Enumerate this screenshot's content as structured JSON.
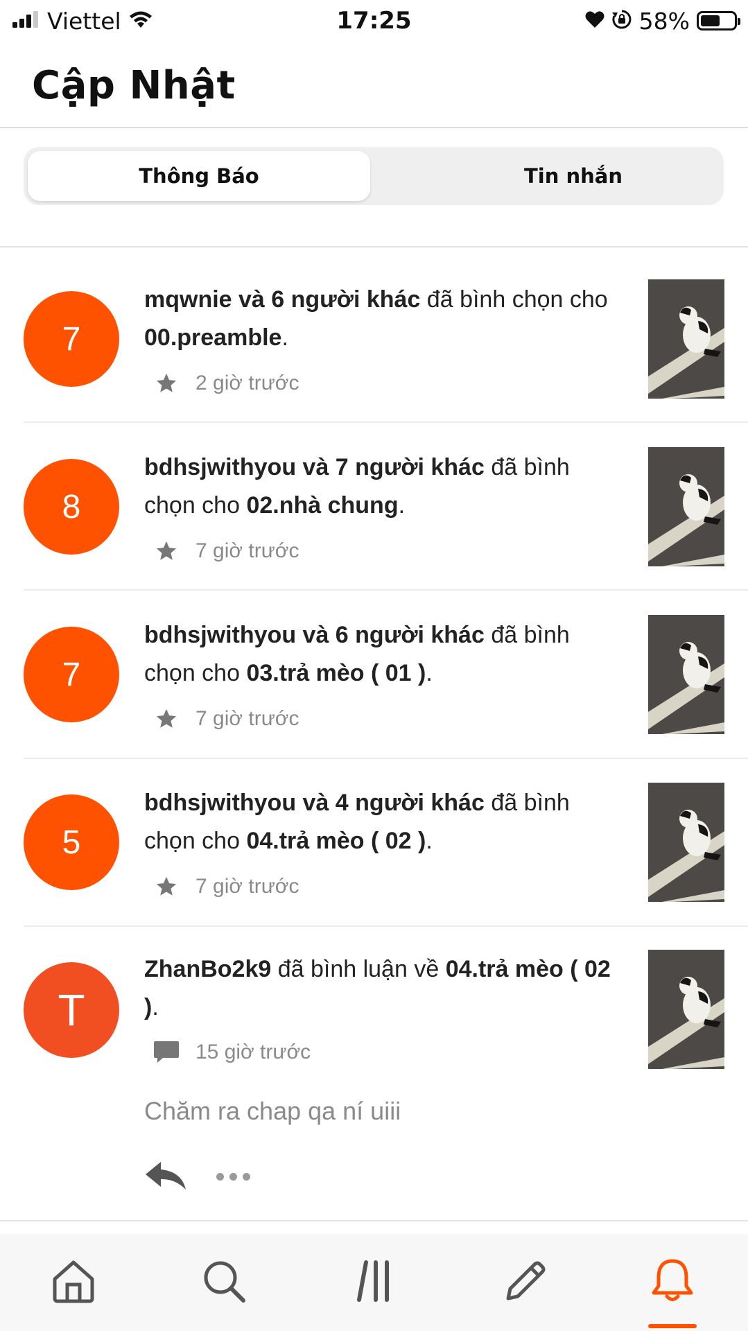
{
  "status_bar": {
    "carrier": "Viettel",
    "time": "17:25",
    "battery_percent": "58%",
    "battery_level": 0.58,
    "icons": [
      "signal-icon",
      "wifi-icon",
      "heart-icon",
      "rotation-lock-icon",
      "battery-icon"
    ]
  },
  "header": {
    "title": "Cập Nhật"
  },
  "tabs": [
    {
      "label": "Thông Báo",
      "active": true
    },
    {
      "label": "Tin nhắn",
      "active": false
    }
  ],
  "notifications": [
    {
      "avatar": "7",
      "actor": "mqwnie và 6 người khác",
      "action": " đã bình chọn cho ",
      "target": "00.preamble",
      "suffix": ".",
      "time": "2 giờ trước",
      "icon": "star-icon"
    },
    {
      "avatar": "8",
      "actor": "bdhsjwithyou và 7 người khác",
      "action": " đã bình chọn cho ",
      "target": "02.nhà chung",
      "suffix": ".",
      "time": "7 giờ trước",
      "icon": "star-icon"
    },
    {
      "avatar": "7",
      "actor": "bdhsjwithyou và 6 người khác",
      "action": " đã bình chọn cho ",
      "target": "03.trả mèo ( 01 )",
      "suffix": ".",
      "time": "7 giờ trước",
      "icon": "star-icon"
    },
    {
      "avatar": "5",
      "actor": "bdhsjwithyou và 4 người khác",
      "action": " đã bình chọn cho ",
      "target": "04.trả mèo ( 02 )",
      "suffix": ".",
      "time": "7 giờ trước",
      "icon": "star-icon"
    },
    {
      "avatar": "T",
      "actor": "ZhanBo2k9",
      "action": " đã bình luận về ",
      "target": "04.trả mèo ( 02 )",
      "suffix": ".",
      "time": "15 giờ trước",
      "icon": "comment-icon",
      "comment": "Chăm ra chap qa ní uiii"
    }
  ],
  "bottom_nav": {
    "items": [
      "home-icon",
      "search-icon",
      "library-icon",
      "write-icon",
      "notifications-bell-icon"
    ],
    "active": "notifications-bell-icon"
  },
  "colors": {
    "accent": "#ff5200",
    "avatar_t": "#f14e22",
    "muted_text": "#8a8a8a"
  }
}
